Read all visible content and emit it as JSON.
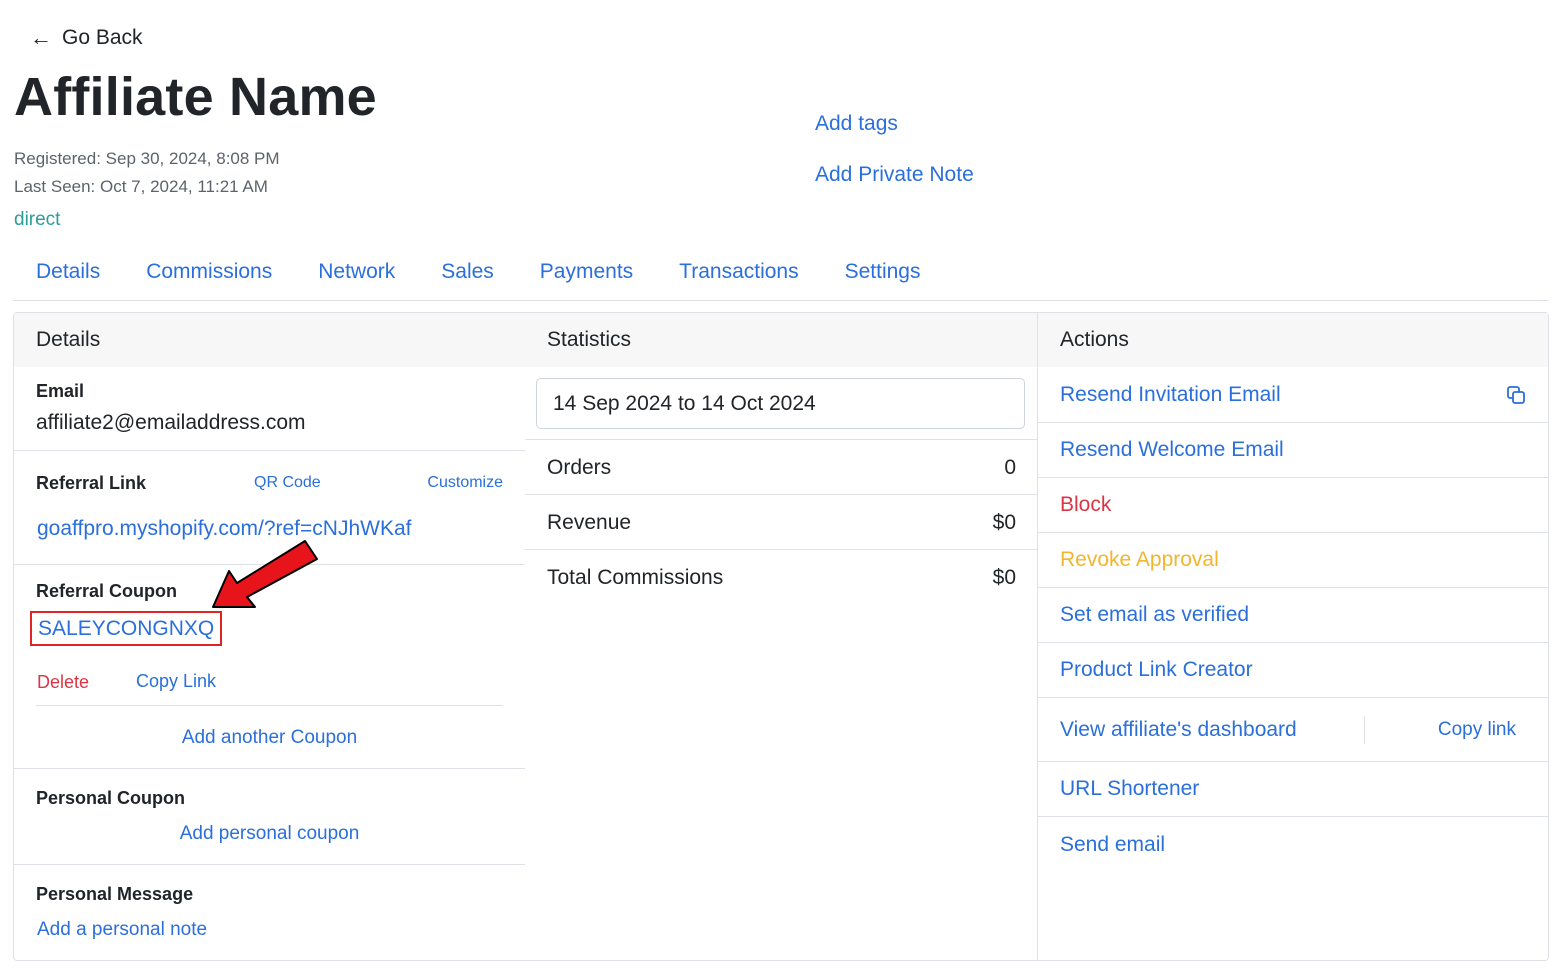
{
  "nav": {
    "back_label": "Go Back"
  },
  "header": {
    "title": "Affiliate Name",
    "registered": "Registered: Sep 30, 2024, 8:08 PM",
    "last_seen": "Last Seen: Oct 7, 2024, 11:21 AM",
    "source": "direct",
    "add_tags": "Add tags",
    "add_private_note": "Add Private Note"
  },
  "tabs": [
    "Details",
    "Commissions",
    "Network",
    "Sales",
    "Payments",
    "Transactions",
    "Settings"
  ],
  "details": {
    "header": "Details",
    "email_label": "Email",
    "email": "affiliate2@emailaddress.com",
    "referral_link_label": "Referral Link",
    "qr_code": "QR Code",
    "customize": "Customize",
    "referral_link": "goaffpro.myshopify.com/?ref=cNJhWKaf",
    "referral_coupon_label": "Referral Coupon",
    "coupon_code": "SALEYCONGNXQ",
    "delete": "Delete",
    "copy_link": "Copy Link",
    "add_another_coupon": "Add another Coupon",
    "personal_coupon_label": "Personal Coupon",
    "add_personal_coupon": "Add personal coupon",
    "personal_message_label": "Personal Message",
    "add_personal_note": "Add a personal note"
  },
  "statistics": {
    "header": "Statistics",
    "date_range": "14 Sep 2024 to 14 Oct 2024",
    "rows": [
      {
        "label": "Orders",
        "value": "0"
      },
      {
        "label": "Revenue",
        "value": "$0"
      },
      {
        "label": "Total Commissions",
        "value": "$0"
      }
    ]
  },
  "actions": {
    "header": "Actions",
    "resend_invitation": "Resend Invitation Email",
    "resend_welcome": "Resend Welcome Email",
    "block": "Block",
    "revoke_approval": "Revoke Approval",
    "set_verified": "Set email as verified",
    "product_link_creator": "Product Link Creator",
    "view_dashboard": "View affiliate's dashboard",
    "copy_link": "Copy link",
    "url_shortener": "URL Shortener",
    "send_email": "Send email"
  },
  "colors": {
    "link": "#2a6fdb",
    "danger": "#dc3545",
    "warning": "#f2b62c",
    "source": "#2a9d9a",
    "annotation": "#e02424"
  },
  "icons": {
    "back": "left-arrow-icon",
    "copy": "copy-icon",
    "annotation": "red-arrow-annotation"
  }
}
